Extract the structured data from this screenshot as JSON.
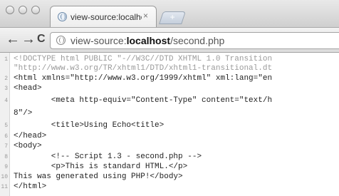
{
  "tab": {
    "title": "view-source:localhost/secon",
    "close_glyph": "×",
    "newtab_glyph": "+"
  },
  "nav": {
    "back_glyph": "←",
    "forward_glyph": "→",
    "reload_glyph": "C"
  },
  "address": {
    "prefix": "view-source:",
    "host": "localhost",
    "path": "/second.php"
  },
  "source": {
    "numbers": [
      "1",
      "",
      "2",
      "3",
      "4",
      "",
      "5",
      "6",
      "7",
      "8",
      "9",
      "10",
      "11"
    ],
    "lines": [
      "<!DOCTYPE html PUBLIC \"-//W3C//DTD XHTML 1.0 Transition",
      "\"http://www.w3.org/TR/xhtml1/DTD/xhtml1-transitional.dt",
      "<html xmlns=\"http://www.w3.org/1999/xhtml\" xml:lang=\"en",
      "<head>",
      "        <meta http-equiv=\"Content-Type\" content=\"text/h",
      "8\"/>",
      "        <title>Using Echo<title>",
      "</head>",
      "<body>",
      "        <!-- Script 1.3 - second.php -->",
      "        <p>This is standard HTML.</p>",
      "This was generated using PHP!</body>",
      "</html>"
    ]
  }
}
